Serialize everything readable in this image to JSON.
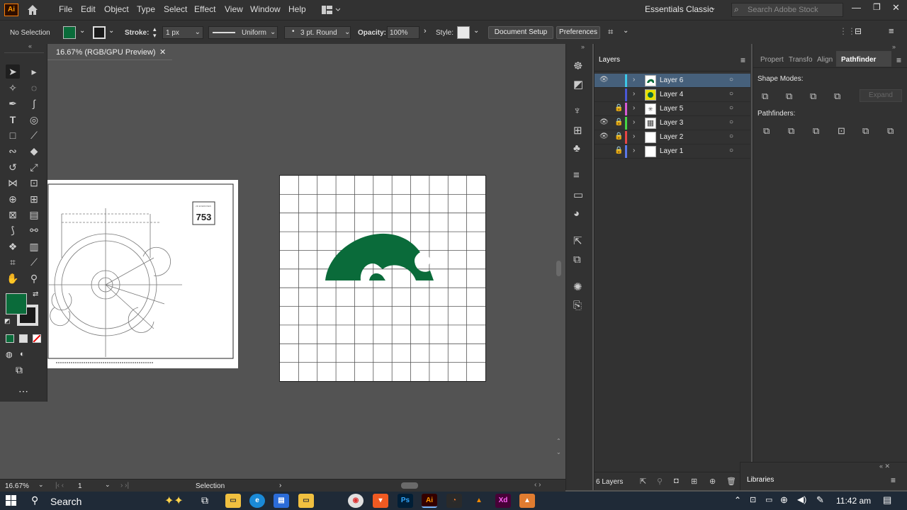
{
  "menubar": {
    "logo": "Ai",
    "items": [
      "File",
      "Edit",
      "Object",
      "Type",
      "Select",
      "Effect",
      "View",
      "Window",
      "Help"
    ],
    "workspace": "Essentials Classic",
    "search_placeholder": "Search Adobe Stock"
  },
  "controlbar": {
    "selection": "No Selection",
    "stroke_label": "Stroke:",
    "stroke_value": "1 px",
    "stroke_profile": "Uniform",
    "brush": "3 pt. Round",
    "opacity_label": "Opacity:",
    "opacity_value": "100%",
    "style_label": "Style:",
    "document_setup": "Document Setup",
    "preferences": "Preferences",
    "fill_color": "#0a6b3a"
  },
  "document": {
    "tab_title": "16.67% (RGB/GPU Preview)",
    "drawing_number": "753",
    "logo_color": "#0a6b3a"
  },
  "layers_panel": {
    "title": "Layers",
    "layers": [
      {
        "name": "Layer 6",
        "color": "#3dc8e8",
        "visible": true,
        "locked": false,
        "selected": true
      },
      {
        "name": "Layer 4",
        "color": "#4a57d6",
        "visible": false,
        "locked": false,
        "selected": false
      },
      {
        "name": "Layer 5",
        "color": "#d65ad6",
        "visible": false,
        "locked": true,
        "selected": false
      },
      {
        "name": "Layer 3",
        "color": "#46d646",
        "visible": true,
        "locked": true,
        "selected": false
      },
      {
        "name": "Layer 2",
        "color": "#e84646",
        "visible": true,
        "locked": true,
        "selected": false
      },
      {
        "name": "Layer 1",
        "color": "#5a78e8",
        "visible": false,
        "locked": true,
        "selected": false
      }
    ],
    "count": "6 Layers"
  },
  "right_panel": {
    "tabs": [
      "Propert",
      "Transfo",
      "Align",
      "Pathfinder"
    ],
    "shape_modes": "Shape Modes:",
    "expand": "Expand",
    "pathfinders": "Pathfinders:",
    "libraries": "Libraries"
  },
  "statusbar": {
    "zoom": "16.67%",
    "artboard": "1",
    "tool": "Selection"
  },
  "taskbar": {
    "search": "Search",
    "time": "11:42 am"
  }
}
